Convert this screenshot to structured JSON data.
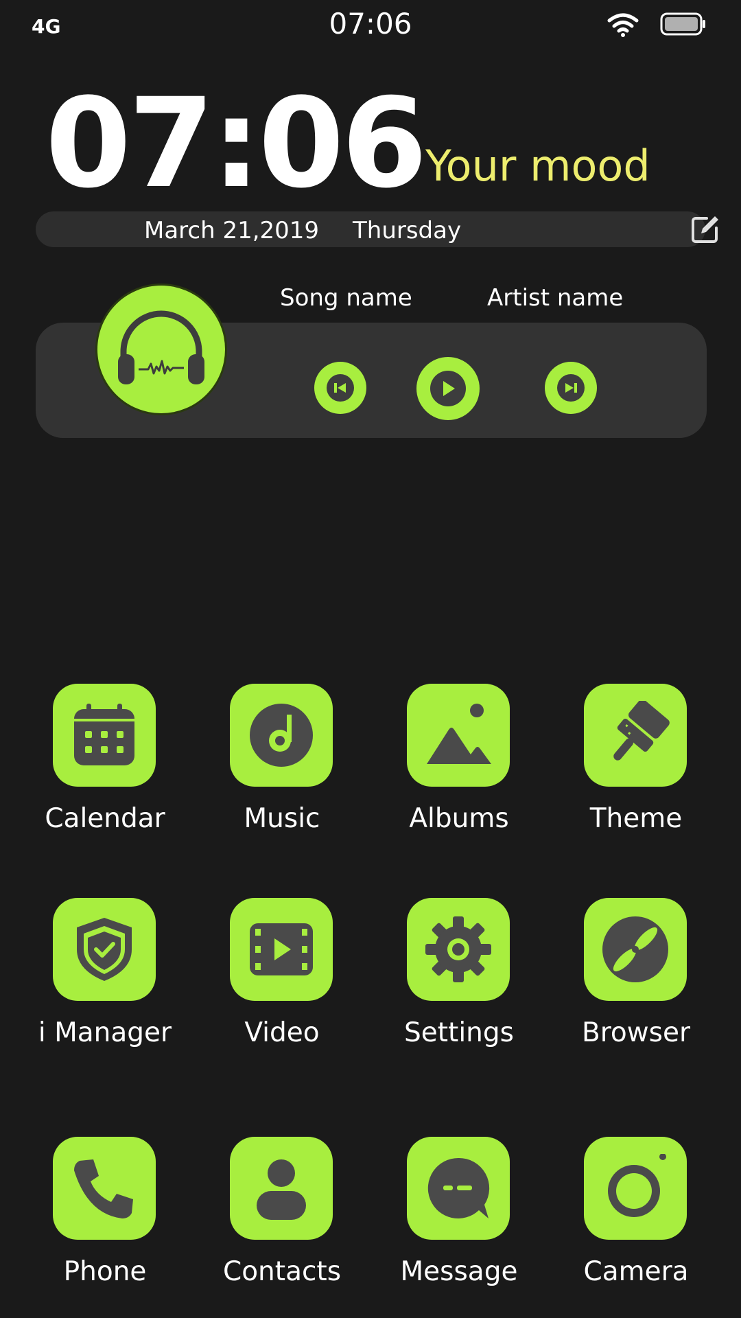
{
  "status_bar": {
    "network": "4G",
    "time": "07:06"
  },
  "clock_widget": {
    "time": "07:06",
    "mood": "Your mood",
    "date": "March 21,2019",
    "day": "Thursday"
  },
  "music_widget": {
    "song_name": "Song name",
    "artist_name": "Artist name"
  },
  "apps": [
    {
      "label": "Calendar",
      "icon": "calendar-icon"
    },
    {
      "label": "Music",
      "icon": "music-disc-icon"
    },
    {
      "label": "Albums",
      "icon": "image-icon"
    },
    {
      "label": "Theme",
      "icon": "paintbrush-icon"
    },
    {
      "label": "i Manager",
      "icon": "shield-check-icon"
    },
    {
      "label": "Video",
      "icon": "film-play-icon"
    },
    {
      "label": "Settings",
      "icon": "gear-icon"
    },
    {
      "label": "Browser",
      "icon": "compass-icon"
    },
    {
      "label": "Phone",
      "icon": "phone-icon"
    },
    {
      "label": "Contacts",
      "icon": "person-icon"
    },
    {
      "label": "Message",
      "icon": "chat-bubble-icon"
    },
    {
      "label": "Camera",
      "icon": "camera-icon"
    }
  ],
  "colors": {
    "background": "#1a1a1a",
    "accent": "#a8ee3f",
    "mood_text": "#eded6e",
    "icon_glyph": "#4a4a4a",
    "panel": "#333333"
  }
}
